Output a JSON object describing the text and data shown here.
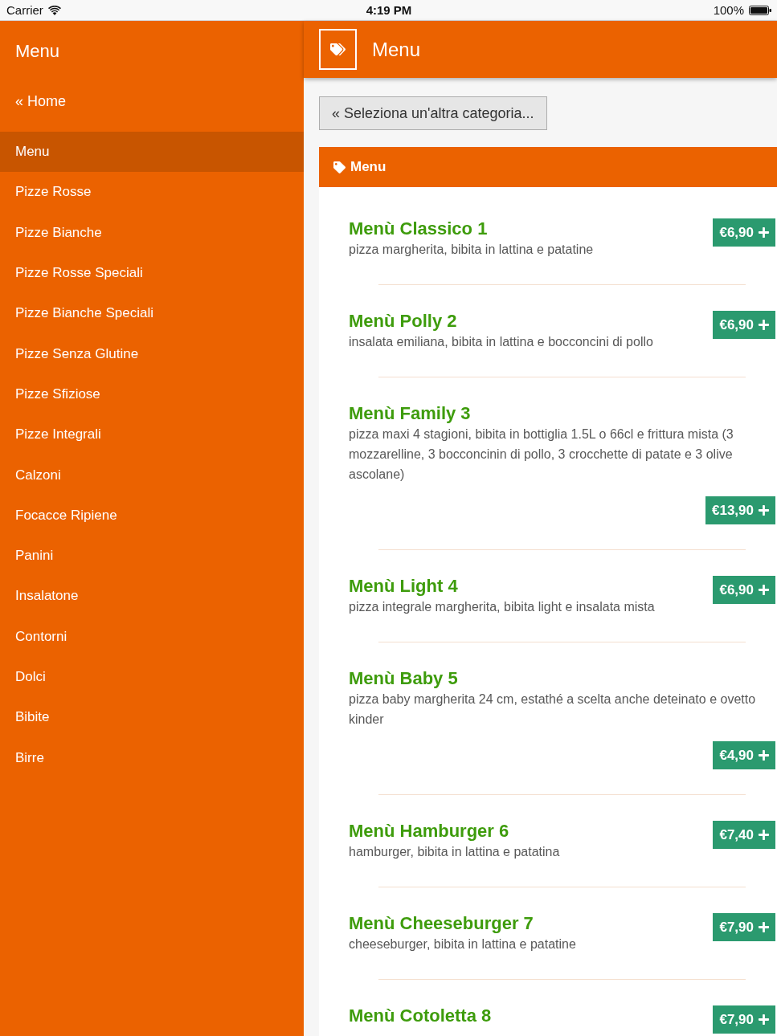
{
  "status_bar": {
    "carrier": "Carrier",
    "time": "4:19 PM",
    "battery": "100%"
  },
  "sidebar": {
    "title": "Menu",
    "home_link": "« Home",
    "items": [
      {
        "label": "Menu",
        "selected": true
      },
      {
        "label": "Pizze Rosse",
        "selected": false
      },
      {
        "label": "Pizze Bianche",
        "selected": false
      },
      {
        "label": "Pizze Rosse Speciali",
        "selected": false
      },
      {
        "label": "Pizze Bianche Speciali",
        "selected": false
      },
      {
        "label": "Pizze Senza Glutine",
        "selected": false
      },
      {
        "label": "Pizze Sfiziose",
        "selected": false
      },
      {
        "label": "Pizze Integrali",
        "selected": false
      },
      {
        "label": "Calzoni",
        "selected": false
      },
      {
        "label": "Focacce Ripiene",
        "selected": false
      },
      {
        "label": "Panini",
        "selected": false
      },
      {
        "label": "Insalatone",
        "selected": false
      },
      {
        "label": "Contorni",
        "selected": false
      },
      {
        "label": "Dolci",
        "selected": false
      },
      {
        "label": "Bibite",
        "selected": false
      },
      {
        "label": "Birre",
        "selected": false
      }
    ]
  },
  "header": {
    "title": "Menu"
  },
  "back_button": "« Seleziona un'altra categoria...",
  "panel": {
    "title": "Menu",
    "items": [
      {
        "kind": "short",
        "name": "Menù Classico 1",
        "description": "pizza margherita, bibita in lattina e patatine",
        "price": "€6,90"
      },
      {
        "kind": "short",
        "name": "Menù Polly 2",
        "description": "insalata emiliana, bibita in lattina e bocconcini di pollo",
        "price": "€6,90"
      },
      {
        "kind": "long",
        "name": "Menù Family 3",
        "description": "pizza maxi 4 stagioni, bibita in bottiglia 1.5L o 66cl e frittura mista (3 mozzarelline, 3 bocconcinin di pollo, 3 crocchette di patate e 3 olive ascolane)",
        "price": "€13,90"
      },
      {
        "kind": "short",
        "name": "Menù Light 4",
        "description": "pizza integrale margherita, bibita light e insalata mista",
        "price": "€6,90"
      },
      {
        "kind": "long",
        "name": "Menù Baby 5",
        "description": "pizza baby margherita 24 cm, estathé a scelta anche deteinato e ovetto kinder",
        "price": "€4,90"
      },
      {
        "kind": "short",
        "name": "Menù Hamburger 6",
        "description": "hamburger, bibita in lattina e patatina",
        "price": "€7,40"
      },
      {
        "kind": "short",
        "name": "Menù Cheeseburger 7",
        "description": "cheeseburger, bibita in lattina e patatine",
        "price": "€7,90"
      },
      {
        "kind": "short",
        "name": "Menù Cotoletta 8",
        "price": "€7,90"
      }
    ]
  }
}
